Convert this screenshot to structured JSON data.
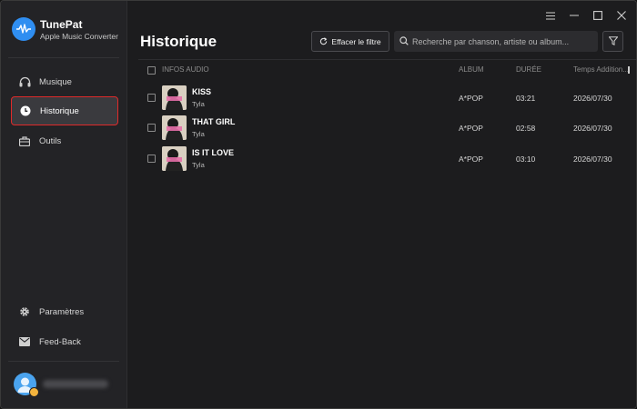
{
  "app": {
    "name": "TunePat",
    "subtitle": "Apple Music Converter"
  },
  "sidebar": {
    "items": [
      {
        "label": "Musique",
        "icon": "headphones-icon",
        "active": false
      },
      {
        "label": "Historique",
        "icon": "clock-icon",
        "active": true
      },
      {
        "label": "Outils",
        "icon": "toolbox-icon",
        "active": false
      }
    ],
    "bottom_items": [
      {
        "label": "Paramètres",
        "icon": "gear-icon"
      },
      {
        "label": "Feed-Back",
        "icon": "mail-icon"
      }
    ]
  },
  "main": {
    "title": "Historique",
    "clear_filter_label": "Effacer le filtre",
    "search_placeholder": "Recherche par chanson, artiste ou album...",
    "columns": {
      "info": "INFOS AUDIO",
      "album": "ALBUM",
      "duration": "DURÉE",
      "added": "Temps Addition..."
    },
    "rows": [
      {
        "title": "KISS",
        "artist": "Tyla",
        "album": "A*POP",
        "duration": "03:21",
        "added": "2026/07/30"
      },
      {
        "title": "THAT GIRL",
        "artist": "Tyla",
        "album": "A*POP",
        "duration": "02:58",
        "added": "2026/07/30"
      },
      {
        "title": "IS IT LOVE",
        "artist": "Tyla",
        "album": "A*POP",
        "duration": "03:10",
        "added": "2026/07/30"
      }
    ]
  },
  "colors": {
    "accent": "#2f8ef1",
    "active_outline": "#e02a2a",
    "background": "#1c1c1e",
    "sidebar": "#232326"
  }
}
